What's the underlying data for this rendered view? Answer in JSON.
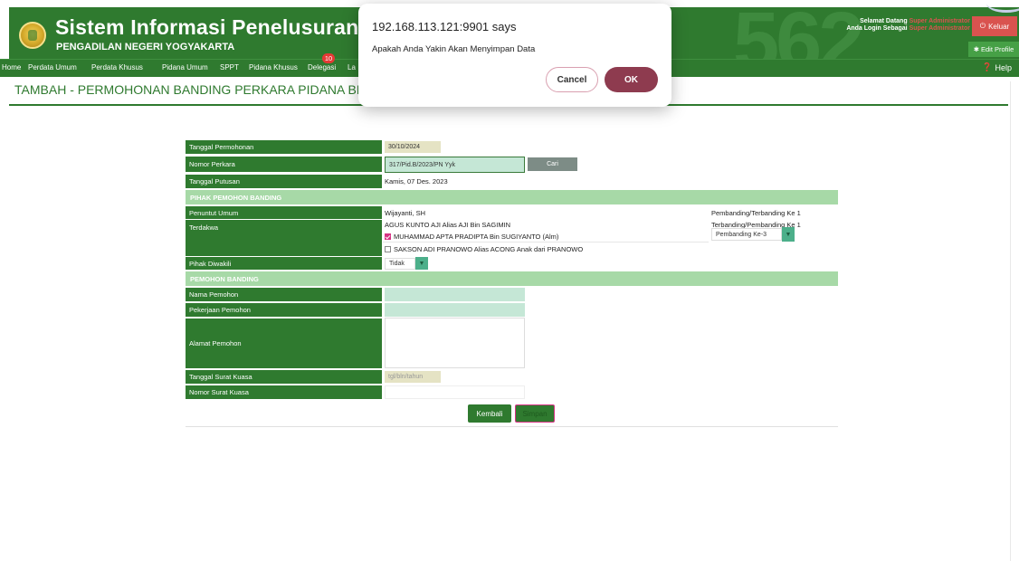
{
  "header": {
    "title": "Sistem Informasi Penelusuran Perkara",
    "subtitle": "PENGADILAN NEGERI YOGYAKARTA",
    "bignum": "562",
    "welcome_line1": "Selamat Datang",
    "welcome_role1": "Super Administrator",
    "welcome_line2": "Anda Login Sebagai",
    "welcome_role2": "Super Administrator",
    "logout_label": "Keluar",
    "edit_profile_label": "Edit Profile"
  },
  "nav": {
    "items": [
      "Home",
      "Perdata Umum",
      "Perdata Khusus",
      "Pidana Umum",
      "SPPT",
      "Pidana Khusus",
      "Delegasi",
      "La"
    ],
    "delegasi_badge": "10",
    "help_label": "Help"
  },
  "page_title": "TAMBAH - PERMOHONAN BANDING PERKARA PIDANA BIASA (e-",
  "form": {
    "tanggal_permohonan_label": "Tanggal Permohonan",
    "tanggal_permohonan_value": "30/10/2024",
    "nomor_perkara_label": "Nomor Perkara",
    "nomor_perkara_value": "317/Pid.B/2023/PN Yyk",
    "cari_label": "Cari",
    "tanggal_putusan_label": "Tanggal Putusan",
    "tanggal_putusan_value": "Kamis, 07 Des. 2023",
    "section_pihak": "PIHAK PEMOHON BANDING",
    "penuntut_label": "Penuntut Umum",
    "penuntut_value": "Wijayanti, SH",
    "penuntut_role": "Pembanding/Terbanding Ke 1",
    "terdakwa_label": "Terdakwa",
    "terdakwa_1": "AGUS KUNTO AJI Alias AJI Bin SAGIMIN",
    "terdakwa_1_role": "Terbanding/Pembanding Ke 1",
    "terdakwa_2": "MUHAMMAD APTA PRADIPTA Bin SUGIYANTO (Alm)",
    "terdakwa_2_role_select": "Pembanding Ke-3",
    "terdakwa_3": "SAKSON ADI PRANOWO Alias ACONG Anak dari PRANOWO",
    "diwakili_label": "Pihak Diwakili",
    "diwakili_value": "Tidak",
    "section_pemohon": "PEMOHON BANDING",
    "nama_label": "Nama Pemohon",
    "pekerjaan_label": "Pekerjaan Pemohon",
    "alamat_label": "Alamat Pemohon",
    "tgl_kuasa_label": "Tanggal Surat Kuasa",
    "tgl_kuasa_placeholder": "tgl/bln/tahun",
    "no_kuasa_label": "Nomor Surat Kuasa",
    "kembali_label": "Kembali",
    "simpan_label": "Simpan"
  },
  "dialog": {
    "origin": "192.168.113.121:9901 says",
    "message": "Apakah Anda Yakin Akan Menyimpan Data",
    "cancel_label": "Cancel",
    "ok_label": "OK"
  },
  "colors": {
    "primary_green": "#2f7a2f",
    "section_green": "#a7d9a7",
    "danger_red": "#d9534f",
    "ok_button": "#8e3b4f"
  }
}
